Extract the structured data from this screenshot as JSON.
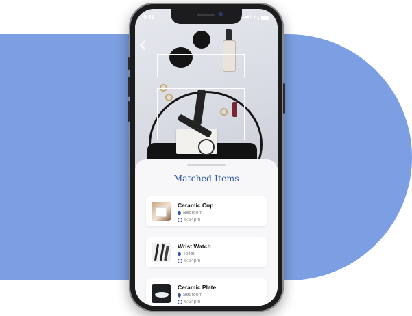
{
  "status_bar": {
    "time": "9:41"
  },
  "sheet": {
    "title": "Matched Items"
  },
  "items": [
    {
      "name": "Ceramic Cup",
      "location": "Bedroom",
      "time": "6:54pm",
      "thumb_icon": "ceramic-cup-photo"
    },
    {
      "name": "Wrist Watch",
      "location": "Toilet",
      "time": "6:54pm",
      "thumb_icon": "wrist-watch-photo"
    },
    {
      "name": "Ceramic Plate",
      "location": "Bedroom",
      "time": "6:54pm",
      "thumb_icon": "ceramic-plate-photo"
    }
  ],
  "colors": {
    "accent": "#2f56a8",
    "background_blob": "#7b9fe2",
    "sheet": "#f7f7f9"
  }
}
